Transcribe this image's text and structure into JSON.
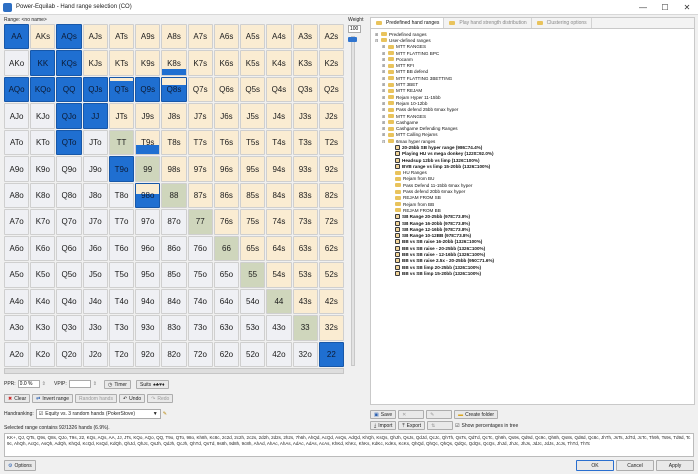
{
  "window": {
    "title": "Power-Equilab - Hand range selection (CO)"
  },
  "range": {
    "label": "Range: <no name>"
  },
  "weight": {
    "label": "Weight",
    "value": "100"
  },
  "grid": [
    [
      [
        "AA",
        "selected"
      ],
      [
        "AKs",
        "suited"
      ],
      [
        "AQs",
        "selected"
      ],
      [
        "AJs",
        "suited"
      ],
      [
        "ATs",
        "suited"
      ],
      [
        "A9s",
        "suited"
      ],
      [
        "A8s",
        "suited"
      ],
      [
        "A7s",
        "suited"
      ],
      [
        "A6s",
        "suited"
      ],
      [
        "A5s",
        "suited"
      ],
      [
        "A4s",
        "suited"
      ],
      [
        "A3s",
        "suited"
      ],
      [
        "A2s",
        "suited"
      ]
    ],
    [
      [
        "AKo",
        "offsuit"
      ],
      [
        "KK",
        "selected"
      ],
      [
        "KQs",
        "selected"
      ],
      [
        "KJs",
        "suited"
      ],
      [
        "KTs",
        "suited"
      ],
      [
        "K9s",
        "suited"
      ],
      [
        "K8s",
        "partial"
      ],
      [
        "K7s",
        "suited"
      ],
      [
        "K6s",
        "suited"
      ],
      [
        "K5s",
        "suited"
      ],
      [
        "K4s",
        "suited"
      ],
      [
        "K3s",
        "suited"
      ],
      [
        "K2s",
        "suited"
      ]
    ],
    [
      [
        "AQo",
        "selected"
      ],
      [
        "KQo",
        "selected"
      ],
      [
        "QQ",
        "selected"
      ],
      [
        "QJs",
        "selected"
      ],
      [
        "QTs",
        "selected"
      ],
      [
        "Q9s",
        "selected"
      ],
      [
        "Q8s",
        "selected"
      ],
      [
        "Q7s",
        "suited"
      ],
      [
        "Q6s",
        "suited"
      ],
      [
        "Q5s",
        "suited"
      ],
      [
        "Q4s",
        "suited"
      ],
      [
        "Q3s",
        "suited"
      ],
      [
        "Q2s",
        "suited"
      ]
    ],
    [
      [
        "AJo",
        "offsuit"
      ],
      [
        "KJo",
        "offsuit"
      ],
      [
        "QJo",
        "selected"
      ],
      [
        "JJ",
        "selected"
      ],
      [
        "JTs",
        "suited"
      ],
      [
        "J9s",
        "suited"
      ],
      [
        "J8s",
        "suited"
      ],
      [
        "J7s",
        "suited"
      ],
      [
        "J6s",
        "suited"
      ],
      [
        "J5s",
        "suited"
      ],
      [
        "J4s",
        "suited"
      ],
      [
        "J3s",
        "suited"
      ],
      [
        "J2s",
        "suited"
      ]
    ],
    [
      [
        "ATo",
        "offsuit"
      ],
      [
        "KTo",
        "offsuit"
      ],
      [
        "QTo",
        "selected"
      ],
      [
        "JTo",
        "offsuit"
      ],
      [
        "TT",
        "pair"
      ],
      [
        "T9s",
        "light"
      ],
      [
        "T8s",
        "suited"
      ],
      [
        "T7s",
        "suited"
      ],
      [
        "T6s",
        "suited"
      ],
      [
        "T5s",
        "suited"
      ],
      [
        "T4s",
        "suited"
      ],
      [
        "T3s",
        "suited"
      ],
      [
        "T2s",
        "suited"
      ]
    ],
    [
      [
        "A9o",
        "offsuit"
      ],
      [
        "K9o",
        "offsuit"
      ],
      [
        "Q9o",
        "offsuit"
      ],
      [
        "J9o",
        "offsuit"
      ],
      [
        "T9o",
        "selected"
      ],
      [
        "99",
        "pair"
      ],
      [
        "98s",
        "suited"
      ],
      [
        "97s",
        "suited"
      ],
      [
        "96s",
        "suited"
      ],
      [
        "95s",
        "suited"
      ],
      [
        "94s",
        "suited"
      ],
      [
        "93s",
        "suited"
      ],
      [
        "92s",
        "suited"
      ]
    ],
    [
      [
        "A8o",
        "offsuit"
      ],
      [
        "K8o",
        "offsuit"
      ],
      [
        "Q8o",
        "offsuit"
      ],
      [
        "J8o",
        "offsuit"
      ],
      [
        "T8o",
        "offsuit"
      ],
      [
        "98o",
        "selected"
      ],
      [
        "88",
        "pair"
      ],
      [
        "87s",
        "suited"
      ],
      [
        "86s",
        "suited"
      ],
      [
        "85s",
        "suited"
      ],
      [
        "84s",
        "suited"
      ],
      [
        "83s",
        "suited"
      ],
      [
        "82s",
        "suited"
      ]
    ],
    [
      [
        "A7o",
        "offsuit"
      ],
      [
        "K7o",
        "offsuit"
      ],
      [
        "Q7o",
        "offsuit"
      ],
      [
        "J7o",
        "offsuit"
      ],
      [
        "T7o",
        "offsuit"
      ],
      [
        "97o",
        "offsuit"
      ],
      [
        "87o",
        "offsuit"
      ],
      [
        "77",
        "pair"
      ],
      [
        "76s",
        "suited"
      ],
      [
        "75s",
        "suited"
      ],
      [
        "74s",
        "suited"
      ],
      [
        "73s",
        "suited"
      ],
      [
        "72s",
        "suited"
      ]
    ],
    [
      [
        "A6o",
        "offsuit"
      ],
      [
        "K6o",
        "offsuit"
      ],
      [
        "Q6o",
        "offsuit"
      ],
      [
        "J6o",
        "offsuit"
      ],
      [
        "T6o",
        "offsuit"
      ],
      [
        "96o",
        "offsuit"
      ],
      [
        "86o",
        "offsuit"
      ],
      [
        "76o",
        "offsuit"
      ],
      [
        "66",
        "pair"
      ],
      [
        "65s",
        "suited"
      ],
      [
        "64s",
        "suited"
      ],
      [
        "63s",
        "suited"
      ],
      [
        "62s",
        "suited"
      ]
    ],
    [
      [
        "A5o",
        "offsuit"
      ],
      [
        "K5o",
        "offsuit"
      ],
      [
        "Q5o",
        "offsuit"
      ],
      [
        "J5o",
        "offsuit"
      ],
      [
        "T5o",
        "offsuit"
      ],
      [
        "95o",
        "offsuit"
      ],
      [
        "85o",
        "offsuit"
      ],
      [
        "75o",
        "offsuit"
      ],
      [
        "65o",
        "offsuit"
      ],
      [
        "55",
        "pair"
      ],
      [
        "54s",
        "suited"
      ],
      [
        "53s",
        "suited"
      ],
      [
        "52s",
        "suited"
      ]
    ],
    [
      [
        "A4o",
        "offsuit"
      ],
      [
        "K4o",
        "offsuit"
      ],
      [
        "Q4o",
        "offsuit"
      ],
      [
        "J4o",
        "offsuit"
      ],
      [
        "T4o",
        "offsuit"
      ],
      [
        "94o",
        "offsuit"
      ],
      [
        "84o",
        "offsuit"
      ],
      [
        "74o",
        "offsuit"
      ],
      [
        "64o",
        "offsuit"
      ],
      [
        "54o",
        "offsuit"
      ],
      [
        "44",
        "pair"
      ],
      [
        "43s",
        "suited"
      ],
      [
        "42s",
        "suited"
      ]
    ],
    [
      [
        "A3o",
        "offsuit"
      ],
      [
        "K3o",
        "offsuit"
      ],
      [
        "Q3o",
        "offsuit"
      ],
      [
        "J3o",
        "offsuit"
      ],
      [
        "T3o",
        "offsuit"
      ],
      [
        "93o",
        "offsuit"
      ],
      [
        "83o",
        "offsuit"
      ],
      [
        "73o",
        "offsuit"
      ],
      [
        "63o",
        "offsuit"
      ],
      [
        "53o",
        "offsuit"
      ],
      [
        "43o",
        "offsuit"
      ],
      [
        "33",
        "pair"
      ],
      [
        "32s",
        "suited"
      ]
    ],
    [
      [
        "A2o",
        "offsuit"
      ],
      [
        "K2o",
        "offsuit"
      ],
      [
        "Q2o",
        "offsuit"
      ],
      [
        "J2o",
        "offsuit"
      ],
      [
        "T2o",
        "offsuit"
      ],
      [
        "92o",
        "offsuit"
      ],
      [
        "82o",
        "offsuit"
      ],
      [
        "72o",
        "offsuit"
      ],
      [
        "62o",
        "offsuit"
      ],
      [
        "52o",
        "offsuit"
      ],
      [
        "42o",
        "offsuit"
      ],
      [
        "32o",
        "offsuit"
      ],
      [
        "22",
        "selected"
      ]
    ]
  ],
  "partial_fill": {
    "K8s": 0.25,
    "Q8s": 0.7,
    "QTs": 0.85,
    "98o": 0.55,
    "99": 0.0,
    "T9s": 0.4
  },
  "controls": {
    "ppr_label": "PPR:",
    "ppr_value": "0.0 %",
    "vpip_label": "VPIP:",
    "vpip_value": "",
    "timer_label": "Timer",
    "suits_label": "Suits",
    "suits_symbols": "♠♣♥♦",
    "clear_label": "Clear",
    "invert_label": "Invert range",
    "random_label": "Random hands",
    "undo_label": "Undo",
    "redo_label": "Redo",
    "handranking_label": "Handranking:",
    "handranking_value": "Equity vs. 3 random hands (PokerStove)"
  },
  "tabs": [
    {
      "label": "Predefined hand ranges",
      "active": true
    },
    {
      "label": "Play hand strength distribution",
      "active": false
    },
    {
      "label": "Clustering options",
      "active": false
    }
  ],
  "tree": [
    {
      "depth": 0,
      "type": "folder",
      "toggle": "+",
      "label": "Predefined ranges",
      "bold": false
    },
    {
      "depth": 0,
      "type": "folder",
      "toggle": "-",
      "label": "User-defined ranges",
      "bold": false
    },
    {
      "depth": 1,
      "type": "folder",
      "toggle": "+",
      "label": "MTT RANGES",
      "bold": false
    },
    {
      "depth": 1,
      "type": "folder",
      "toggle": "+",
      "label": "MTT FLATTING BPC",
      "bold": false
    },
    {
      "depth": 1,
      "type": "folder",
      "toggle": "+",
      "label": "Pocanm",
      "bold": false
    },
    {
      "depth": 1,
      "type": "folder",
      "toggle": "+",
      "label": "MTT RFI",
      "bold": false
    },
    {
      "depth": 1,
      "type": "folder",
      "toggle": "+",
      "label": "MTT BB defend",
      "bold": false
    },
    {
      "depth": 1,
      "type": "folder",
      "toggle": "+",
      "label": "MTT FLATTING 3BETTING",
      "bold": false
    },
    {
      "depth": 1,
      "type": "folder",
      "toggle": "+",
      "label": "MTT 3BET",
      "bold": false
    },
    {
      "depth": 1,
      "type": "folder",
      "toggle": "+",
      "label": "MTT REJAM",
      "bold": false
    },
    {
      "depth": 1,
      "type": "folder",
      "toggle": "+",
      "label": "Rejam Hyper 11-15bb",
      "bold": false
    },
    {
      "depth": 1,
      "type": "folder",
      "toggle": "+",
      "label": "Rejam 10-12bb",
      "bold": false
    },
    {
      "depth": 1,
      "type": "folder",
      "toggle": "+",
      "label": "Pass defend 25bb 6max hyper",
      "bold": false
    },
    {
      "depth": 1,
      "type": "folder",
      "toggle": "+",
      "label": "MTT RANGES",
      "bold": false
    },
    {
      "depth": 1,
      "type": "folder",
      "toggle": "+",
      "label": "Cashgame",
      "bold": false
    },
    {
      "depth": 1,
      "type": "folder",
      "toggle": "+",
      "label": "Cashgame Defending Ranges",
      "bold": false
    },
    {
      "depth": 1,
      "type": "folder",
      "toggle": "+",
      "label": "MTT Calling Rejams",
      "bold": false
    },
    {
      "depth": 1,
      "type": "folder",
      "toggle": "-",
      "label": "6max hyper ranges",
      "bold": false
    },
    {
      "depth": 2,
      "type": "leaf",
      "toggle": "",
      "label": "20-25bb SB hyper range (986=74.4%)",
      "bold": true
    },
    {
      "depth": 2,
      "type": "leaf",
      "toggle": "",
      "label": "Playing HU vs mega donkey (1220=92.0%)",
      "bold": true
    },
    {
      "depth": 2,
      "type": "leaf",
      "toggle": "",
      "label": "Headsup 12bb vs limp (1326=100%)",
      "bold": true
    },
    {
      "depth": 2,
      "type": "leaf",
      "toggle": "",
      "label": "BVB range vs limp 15-20bb (1326=100%)",
      "bold": true
    },
    {
      "depth": 2,
      "type": "folder",
      "toggle": "",
      "label": "HU Ranges",
      "bold": false
    },
    {
      "depth": 2,
      "type": "folder",
      "toggle": "",
      "label": "Rejam from BU",
      "bold": false
    },
    {
      "depth": 2,
      "type": "folder",
      "toggle": "",
      "label": "Pass Defend 11-15bb 6max hyper",
      "bold": false
    },
    {
      "depth": 2,
      "type": "folder",
      "toggle": "",
      "label": "Pass defend 20bb 6max hyper",
      "bold": false
    },
    {
      "depth": 2,
      "type": "folder",
      "toggle": "",
      "label": "REJAM FROM SB",
      "bold": false
    },
    {
      "depth": 2,
      "type": "folder",
      "toggle": "",
      "label": "Rejam from BB",
      "bold": false
    },
    {
      "depth": 2,
      "type": "folder",
      "toggle": "",
      "label": "REJAM FROM BB",
      "bold": false
    },
    {
      "depth": 2,
      "type": "leaf",
      "toggle": "",
      "label": "SB Range 20-25bb (978=73.8%)",
      "bold": true
    },
    {
      "depth": 2,
      "type": "leaf",
      "toggle": "",
      "label": "SB Range 16-20bb (978=73.8%)",
      "bold": true
    },
    {
      "depth": 2,
      "type": "leaf",
      "toggle": "",
      "label": "SB Range 12-16bb (978=73.8%)",
      "bold": true
    },
    {
      "depth": 2,
      "type": "leaf",
      "toggle": "",
      "label": "SB Range 10-12BB (978=73.8%)",
      "bold": true
    },
    {
      "depth": 2,
      "type": "leaf",
      "toggle": "",
      "label": "BB vs SB raise 16-20bb (1326=100%)",
      "bold": true
    },
    {
      "depth": 2,
      "type": "leaf",
      "toggle": "",
      "label": "BB vs SB raise - 20-25bb (1326=100%)",
      "bold": true
    },
    {
      "depth": 2,
      "type": "leaf",
      "toggle": "",
      "label": "BB vs SB raise - 12-16bb (1326=100%)",
      "bold": true
    },
    {
      "depth": 2,
      "type": "leaf",
      "toggle": "",
      "label": "BB vs SB raise 2.5x - 20-25bb (950=71.6%)",
      "bold": true
    },
    {
      "depth": 2,
      "type": "leaf",
      "toggle": "",
      "label": "BB vs SB limp 20-25bb (1326=100%)",
      "bold": true
    },
    {
      "depth": 2,
      "type": "leaf",
      "toggle": "",
      "label": "BB vs SB limp 15-20bb (1326=100%)",
      "bold": true
    }
  ],
  "rp_toolbar": {
    "save_label": "Save",
    "import_label": "Import",
    "export_label": "Export",
    "create_folder_label": "Create folder",
    "show_pct_label": "Show percentages in tree"
  },
  "selection": {
    "info": "Selected range contains 92/1326 hands (6.9%).",
    "text": "KK+, QJ, QTs, Q9s, Q8s, QJo, T9s, 22, KQs, AQs, AA, JJ, JTs, KQo, AQo, QQ, T9o, QTo, 98o, Kh8h, Kc8c, 2c2d, 2c2h, 2c2s, 2d2h, 2d2s, 2h2s, 7h6h, AhQd, AcQd, AsQs, AdQd, KhQh, KsQs, QhJh, QsJs, QdJd, QcJc, QhTh, QsTs, QdTd, QcTc, Qh9h, Qs9s, Qd9d, Qc9c, Qh8h, Qs8s, Qd8d, Qc8c, JhTh, JsTs, JdTd, JcTc, Th9h, Ts9s, Td9d, Tc9c, AhQh, AcQc, AsQh, AdQh, KhQd, KcQd, KsQd, KdQh, QhJd, QhJc, QsJh, QdJh, QcJh, QhTd, QsTd, 9s8h, 9d8h, 9c8h, AhAd, AhAc, AhAs, AdAc, AdAs, AcAs, KhKd, KhKc, KhKs, KdKc, KdKs, KcKs, QhQd, QhQc, QhQs, QdQc, QdQs, QcQs, JhJd, JhJc, JhJs, JdJc, JdJs, JcJs, ThTd, ThTc"
  },
  "bottom": {
    "options_label": "Options",
    "ok_label": "OK",
    "cancel_label": "Cancel",
    "apply_label": "Apply"
  },
  "colors": {
    "selected": "#1f6fd1",
    "suited": "#faecd2",
    "offsuit": "#eff0f4",
    "pair": "#cfd6bc"
  }
}
